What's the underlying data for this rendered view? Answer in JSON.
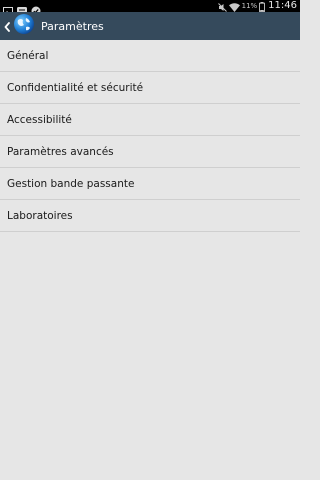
{
  "status_bar": {
    "time": "11:46",
    "battery_percent": "11%",
    "icons": [
      "picture-icon",
      "messenger-icon",
      "check-badge-icon",
      "mute-icon",
      "wifi-icon",
      "battery-icon"
    ]
  },
  "action_bar": {
    "title": "Paramètres",
    "icons": [
      "back-chevron-icon",
      "globe-app-icon"
    ],
    "colors": {
      "background": "#354a5c",
      "title": "#ffffff"
    }
  },
  "settings_list": {
    "items": [
      {
        "label": "Général"
      },
      {
        "label": "Confidentialité et sécurité"
      },
      {
        "label": "Accessibilité"
      },
      {
        "label": "Paramètres avancés"
      },
      {
        "label": "Gestion bande passante"
      },
      {
        "label": "Laboratoires"
      }
    ],
    "colors": {
      "background": "#e6e6e6",
      "divider": "#cfcfcf",
      "text": "#1a1a1a"
    }
  }
}
